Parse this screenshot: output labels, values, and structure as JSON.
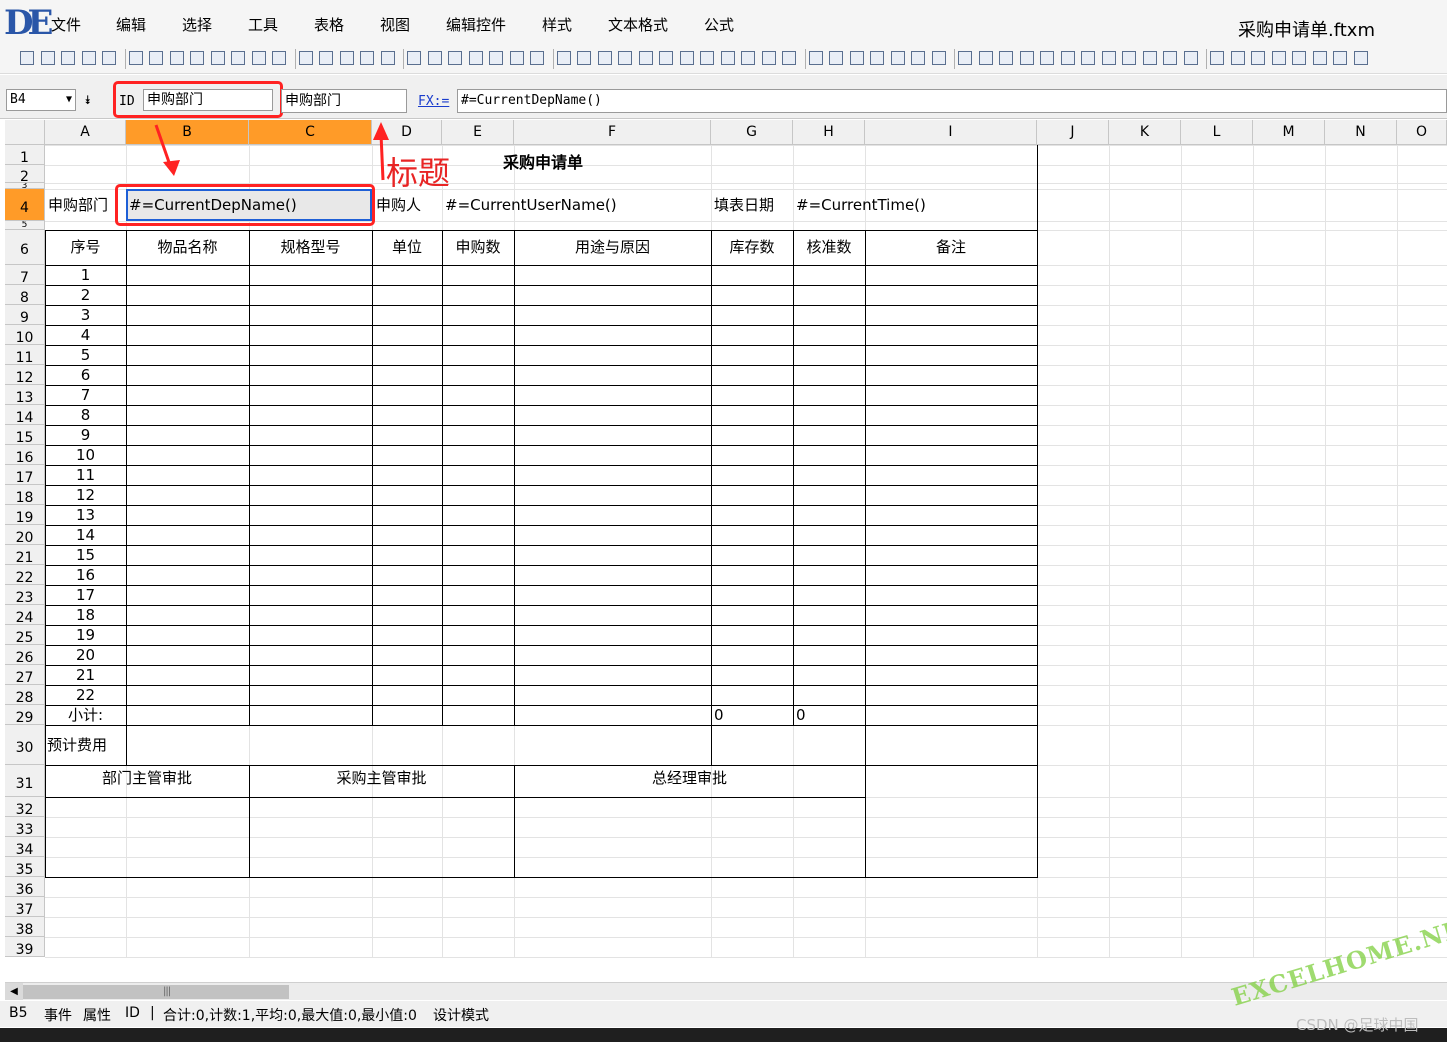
{
  "app": {
    "logo_text": "DE",
    "file_title": "采购申请单.ftxm",
    "menu": [
      "文件",
      "编辑",
      "选择",
      "工具",
      "表格",
      "视图",
      "编辑控件",
      "样式",
      "文本格式",
      "公式"
    ]
  },
  "toolbar": {
    "icons": [
      "save-icon",
      "undo-icon",
      "redo-icon",
      "record-icon",
      "play-icon",
      "table-icon",
      "edit-icon",
      "form-icon",
      "window-icon",
      "brush-icon",
      "grid-icon",
      "hide-icon",
      "eye-icon",
      "border-all-icon",
      "border-inner-icon",
      "border-left-icon",
      "border-top-icon",
      "border-bottom-icon",
      "align-left-icon",
      "align-center-icon",
      "align-right-icon",
      "align-justify-icon",
      "align-top-icon",
      "align-middle-icon",
      "align-bottom-icon",
      "asterisk-icon",
      "font-grow-icon",
      "font-shrink-icon",
      "underline-icon",
      "italic-icon",
      "bold-icon",
      "fill-color-icon",
      "image-icon",
      "image-edit-icon",
      "font-color-icon",
      "chart-icon",
      "picture-icon",
      "merge-icon",
      "split-icon",
      "insert-row-icon",
      "insert-col-icon",
      "delete-icon",
      "sort-icon",
      "filter-icon",
      "textbox-icon",
      "label-icon",
      "text-icon",
      "radio-icon",
      "checkbox-icon",
      "list-icon",
      "combo-icon",
      "number-icon",
      "button-icon",
      "slider-icon",
      "date-icon",
      "formula-icon",
      "currency-icon",
      "dollar-icon",
      "percent-icon",
      "decimal-icon",
      "thousands-icon",
      "calendar-icon",
      "grid-view-icon",
      "layout-icon"
    ]
  },
  "formula_bar": {
    "cell_ref": "B4",
    "expand_symbol": "⯯",
    "id_label": "ID",
    "id_value": "申购部门",
    "title_value": "申购部门",
    "fx_label": "FX:=",
    "formula": "#=CurrentDepName()"
  },
  "annotation": {
    "title_label": "标题"
  },
  "sheet": {
    "columns": [
      "A",
      "B",
      "C",
      "D",
      "E",
      "F",
      "G",
      "H",
      "I",
      "J",
      "K",
      "L",
      "M",
      "N",
      "O"
    ],
    "selected_columns": [
      "B",
      "C"
    ],
    "rows": [
      "1",
      "2",
      "3",
      "4",
      "5",
      "6",
      "7",
      "8",
      "9",
      "10",
      "11",
      "12",
      "13",
      "14",
      "15",
      "16",
      "17",
      "18",
      "19",
      "20",
      "21",
      "22",
      "23",
      "24",
      "25",
      "26",
      "27",
      "28",
      "29",
      "30",
      "31",
      "32",
      "33",
      "34",
      "35",
      "36",
      "37",
      "38",
      "39"
    ],
    "selected_row": "4",
    "form_title": "采购申请单",
    "row4": {
      "dept_label": "申购部门",
      "dept_formula": "#=CurrentDepName()",
      "buyer_label": "申购人",
      "buyer_formula": "#=CurrentUserName()",
      "date_label": "填表日期",
      "date_formula": "#=CurrentTime()"
    },
    "table_headers": [
      "序号",
      "物品名称",
      "规格型号",
      "单位",
      "申购数",
      "用途与原因",
      "库存数",
      "核准数",
      "备注"
    ],
    "serials": [
      "1",
      "2",
      "3",
      "4",
      "5",
      "6",
      "7",
      "8",
      "9",
      "10",
      "11",
      "12",
      "13",
      "14",
      "15",
      "16",
      "17",
      "18",
      "19",
      "20",
      "21",
      "22"
    ],
    "subtotal_label": "小计:",
    "subtotal_stock": "0",
    "subtotal_approved": "0",
    "estimate_label": "预计费用",
    "approvals": [
      "部门主管审批",
      "采购主管审批",
      "总经理审批"
    ]
  },
  "status": {
    "cell": "B5",
    "items": [
      "事件",
      "属性",
      "ID"
    ],
    "separator": "|",
    "summary": "合计:0,计数:1,平均:0,最大值:0,最小值:0",
    "mode": "设计模式"
  },
  "watermarks": {
    "site": "EXCELHOME.NET",
    "csdn": "CSDN @足球中国"
  }
}
